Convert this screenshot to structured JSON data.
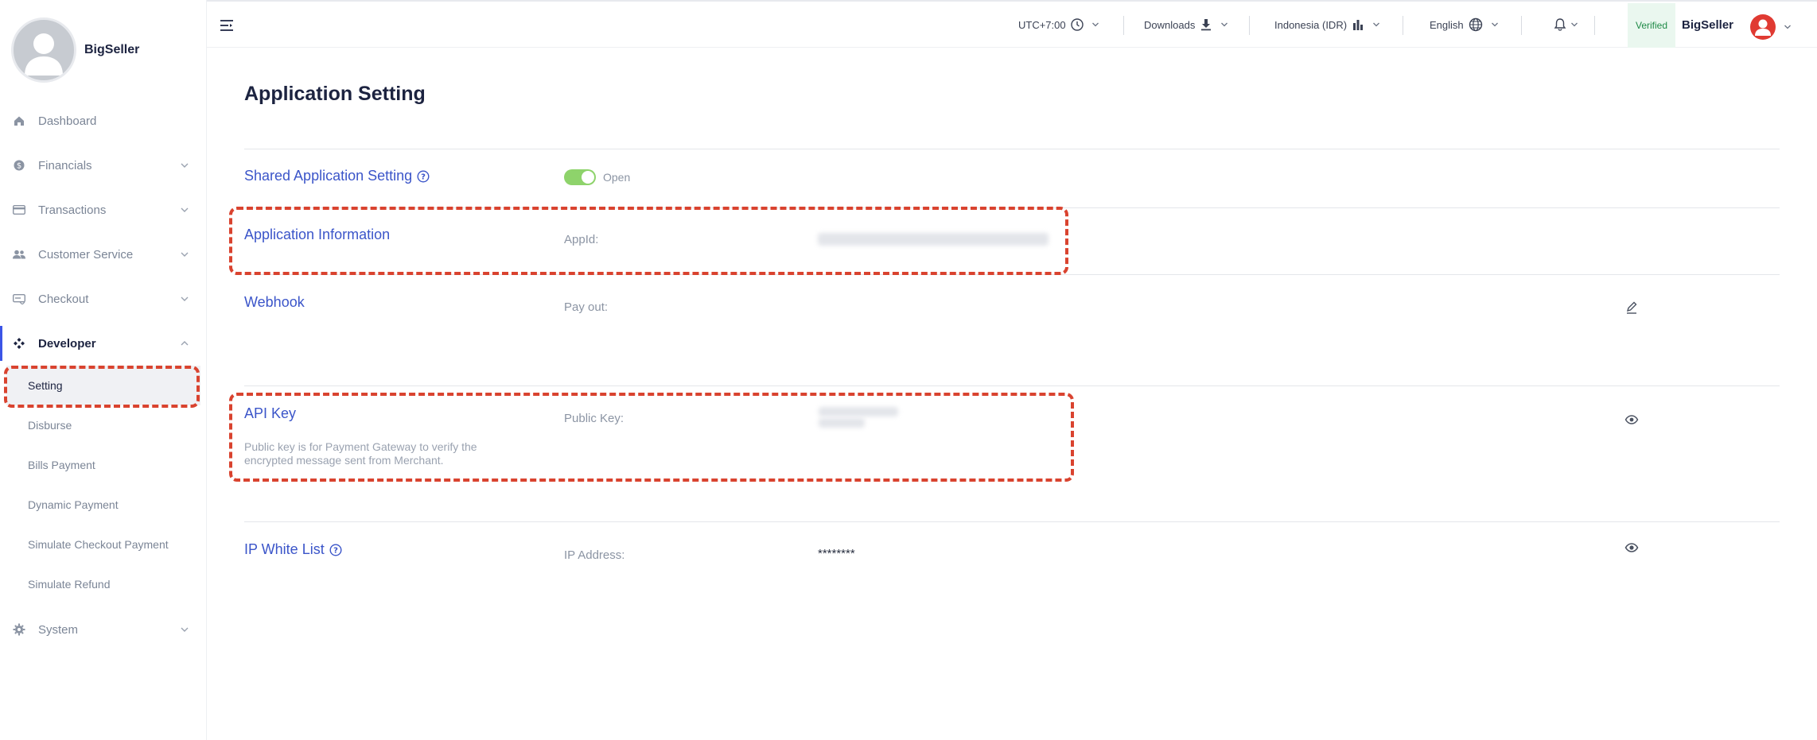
{
  "sidebar": {
    "brand_name": "BigSeller",
    "items": [
      {
        "label": "Dashboard"
      },
      {
        "label": "Financials"
      },
      {
        "label": "Transactions"
      },
      {
        "label": "Customer Service"
      },
      {
        "label": "Checkout"
      },
      {
        "label": "Developer"
      },
      {
        "label": "System"
      }
    ],
    "developer_sub": [
      {
        "label": "Setting"
      },
      {
        "label": "Disburse"
      },
      {
        "label": "Bills Payment"
      },
      {
        "label": "Dynamic Payment"
      },
      {
        "label": "Simulate Checkout Payment"
      },
      {
        "label": "Simulate Refund"
      }
    ]
  },
  "topbar": {
    "timezone": "UTC+7:00",
    "downloads": "Downloads",
    "region": "Indonesia (IDR)",
    "language": "English",
    "verified": "Verified",
    "user_name": "BigSeller"
  },
  "page": {
    "title": "Application Setting",
    "shared": {
      "title": "Shared Application Setting",
      "toggle_label": "Open"
    },
    "app_info": {
      "title": "Application Information",
      "label": "AppId:"
    },
    "webhook": {
      "title": "Webhook",
      "label": "Pay out:"
    },
    "api_key": {
      "title": "API Key",
      "desc": "Public key is for Payment Gateway to verify the encrypted message sent from Merchant.",
      "label": "Public Key:"
    },
    "ip_whitelist": {
      "title": "IP White List",
      "label": "IP Address:",
      "value": "********"
    }
  },
  "colors": {
    "accent": "#3b55c9",
    "annotation": "#d9432f",
    "toggle_on": "#8ed36b",
    "verified_bg": "#eaf7ef"
  }
}
